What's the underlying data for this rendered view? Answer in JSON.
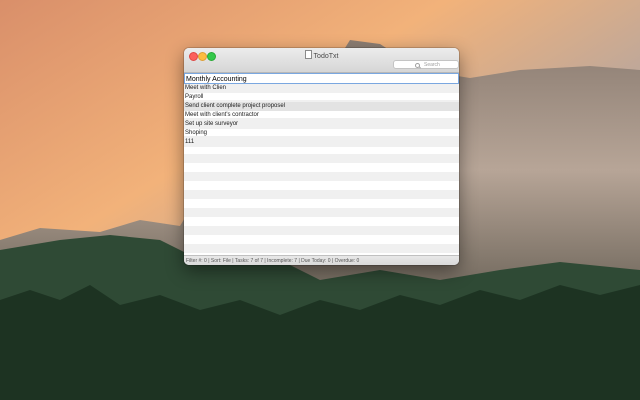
{
  "window": {
    "title": "TodoTxt",
    "search_placeholder": "Search",
    "status_text": "Filter #: 0 | Sort: File | Tasks: 7 of 7 | Incomplete: 7 | Due Today: 0 | Overdue: 0"
  },
  "tasks": {
    "editing_value": "Monthly Accounting",
    "items": [
      {
        "text": "Meet with Clien"
      },
      {
        "text": "Payroll"
      },
      {
        "text": "Send client complete project proposel"
      },
      {
        "text": "Meet with client's contractor"
      },
      {
        "text": "Set up site surveyor"
      },
      {
        "text": "Shoping"
      },
      {
        "text": "111"
      }
    ]
  },
  "colors": {
    "close": "#fc605c",
    "minimize": "#fdbc40",
    "maximize": "#34c84a",
    "focus_ring": "#7aa7e0"
  }
}
